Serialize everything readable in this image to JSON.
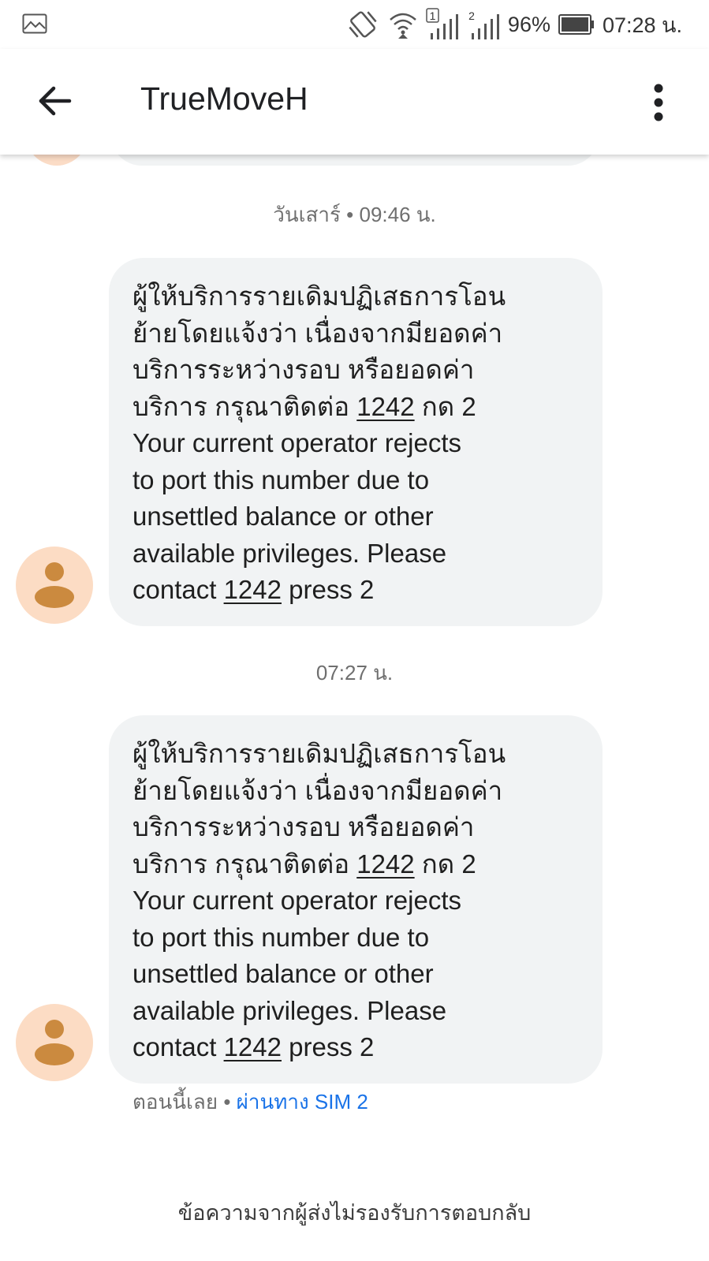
{
  "status_bar": {
    "battery": "96%",
    "time": "07:28 น.",
    "sim1_label": "1",
    "sim2_label": "2"
  },
  "app_bar": {
    "title": "TrueMoveH"
  },
  "messages": [
    {
      "timestamp": "วันเสาร์ • 09:46 น.",
      "lines": [
        [
          "ผู้ให้บริการรายเดิมปฏิเสธการโอน"
        ],
        [
          "ย้ายโดยแจ้งว่า เนื่องจากมียอดค่า"
        ],
        [
          "บริการระหว่างรอบ หรือยอดค่า"
        ],
        [
          "บริการ กรุณาติดต่อ ",
          "1242",
          " กด 2"
        ],
        [
          "Your current operator rejects"
        ],
        [
          "to port this number due to"
        ],
        [
          "unsettled balance or other"
        ],
        [
          "available privileges. Please"
        ],
        [
          "contact ",
          "1242",
          " press 2"
        ]
      ]
    },
    {
      "timestamp": "07:27 น.",
      "lines": [
        [
          "ผู้ให้บริการรายเดิมปฏิเสธการโอน"
        ],
        [
          "ย้ายโดยแจ้งว่า เนื่องจากมียอดค่า"
        ],
        [
          "บริการระหว่างรอบ หรือยอดค่า"
        ],
        [
          "บริการ กรุณาติดต่อ ",
          "1242",
          " กด 2"
        ],
        [
          "Your current operator rejects"
        ],
        [
          "to port this number due to"
        ],
        [
          "unsettled balance or other"
        ],
        [
          "available privileges. Please"
        ],
        [
          "contact ",
          "1242",
          " press 2"
        ]
      ],
      "meta_time": "ตอนนี้เลย • ",
      "meta_sim": "ผ่านทาง SIM 2"
    }
  ],
  "footer": {
    "no_reply": "ข้อความจากผู้ส่งไม่รองรับการตอบกลับ"
  }
}
